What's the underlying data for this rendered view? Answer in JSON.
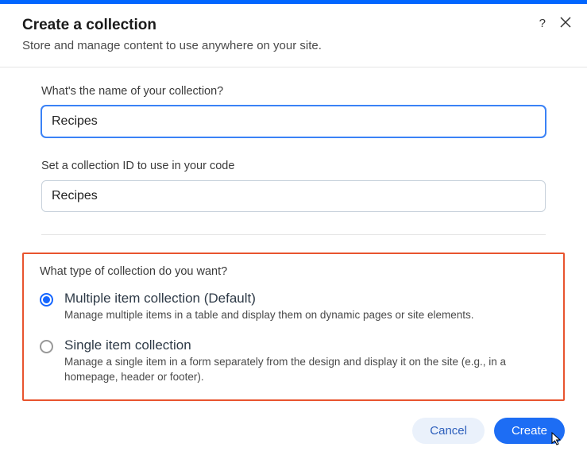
{
  "header": {
    "title": "Create a collection",
    "subtitle": "Store and manage content to use anywhere on your site."
  },
  "form": {
    "name_label": "What's the name of your collection?",
    "name_value": "Recipes",
    "id_label": "Set a collection ID to use in your code",
    "id_value": "Recipes"
  },
  "type_section": {
    "label": "What type of collection do you want?",
    "options": [
      {
        "title": "Multiple item collection (Default)",
        "desc": "Manage multiple items in a table and display them on dynamic pages or site elements.",
        "selected": true
      },
      {
        "title": "Single item collection",
        "desc": "Manage a single item in a form separately from the design and display it on the site (e.g., in a homepage, header or footer).",
        "selected": false
      }
    ]
  },
  "buttons": {
    "cancel": "Cancel",
    "create": "Create"
  }
}
